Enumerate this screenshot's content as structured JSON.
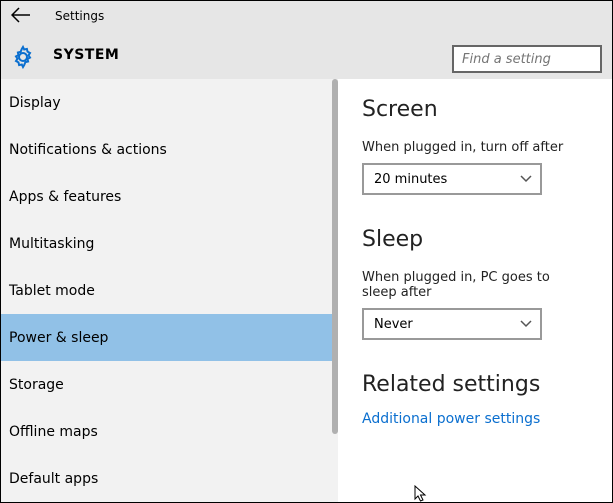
{
  "header": {
    "app_title": "Settings",
    "section_title": "SYSTEM",
    "search_placeholder": "Find a setting"
  },
  "sidebar": {
    "items": [
      {
        "label": "Display",
        "selected": false
      },
      {
        "label": "Notifications & actions",
        "selected": false
      },
      {
        "label": "Apps & features",
        "selected": false
      },
      {
        "label": "Multitasking",
        "selected": false
      },
      {
        "label": "Tablet mode",
        "selected": false
      },
      {
        "label": "Power & sleep",
        "selected": true
      },
      {
        "label": "Storage",
        "selected": false
      },
      {
        "label": "Offline maps",
        "selected": false
      },
      {
        "label": "Default apps",
        "selected": false
      }
    ]
  },
  "content": {
    "screen": {
      "heading": "Screen",
      "label": "When plugged in, turn off after",
      "value": "20 minutes"
    },
    "sleep": {
      "heading": "Sleep",
      "label": "When plugged in, PC goes to sleep after",
      "value": "Never"
    },
    "related": {
      "heading": "Related settings",
      "link": "Additional power settings"
    }
  }
}
